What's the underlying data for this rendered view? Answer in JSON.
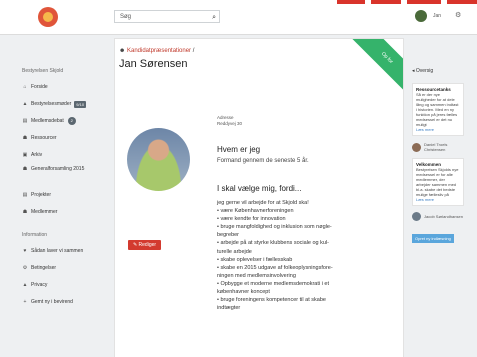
{
  "topbar": {
    "search_placeholder": "Søg",
    "user_name": "Jan"
  },
  "sidebar": {
    "heading": "Bestyrelsen Skjold",
    "items": [
      {
        "label": "Forside",
        "icon": "home-icon"
      },
      {
        "label": "Bestyrelsesmøder",
        "icon": "file-icon",
        "badge": "9/10"
      },
      {
        "label": "Medlemsdebat",
        "icon": "chat-icon",
        "badge": "2"
      },
      {
        "label": "Ressourcer",
        "icon": "people-icon"
      },
      {
        "label": "Arkiv",
        "icon": "archive-icon"
      },
      {
        "label": "Generalforsamling 2015",
        "icon": "people-icon"
      },
      {
        "label": "Projekter",
        "icon": "folder-icon"
      },
      {
        "label": "Medlemmer",
        "icon": "people-icon"
      }
    ],
    "info_heading": "Information",
    "info_items": [
      {
        "label": "Sådan laver vi sammen",
        "icon": "heart-icon"
      },
      {
        "label": "Betingelser",
        "icon": "gear-icon"
      },
      {
        "label": "Privacy",
        "icon": "lock-icon"
      },
      {
        "label": "Gemt ny i bevirend",
        "icon": "plus-icon"
      }
    ]
  },
  "main": {
    "breadcrumb_link": "Kandidatpræsentationer",
    "breadcrumb_sep": "/",
    "person_name": "Jan Sørensen",
    "ribbon_label": "Op for",
    "edit_button": "Rediger",
    "meta_line1": "Adresse",
    "meta_line2": "Reddyvej 30",
    "heading1": "Hvem er jeg",
    "subline": "Formand gennem de seneste 5 år.",
    "heading2": "I skal vælge mig, fordi...",
    "body_lines": [
      "jeg gerne vil arbejde for at Skjold ska!",
      "• være Københavnerforeningen",
      "• være kendte for innovation",
      "• bruge mangfoldighed og inklusion som nøgle-",
      "begreber",
      "• arbejde på at styrke klubbens sociale og kul-",
      "turelle arbejde",
      "• skabe oplevelser i fællesskab",
      "• skabe en 2015 udgave af folkeoplysningsfore-",
      "ningen med medlemsinvolvering",
      "• Opbygge et moderne medlemsdemokrati i et",
      "københavner koncept",
      "• bruge foreningens kompetencer til at skabe",
      "indtægter"
    ]
  },
  "rside": {
    "top_label": "Oversig",
    "card1_title": "Ressourcetanks",
    "card1_text": "Så er der nye muligheder for at dele lång og sammen indtast i historien. Med en ny funktion på jeres fælles medsessel er det nu muligt",
    "card1_link": "Læs mere",
    "user1": "Daniel Troels Christensen",
    "card2_title": "Velkommen",
    "card2_text": "Bestyrelsen Skjolds nye medsessel er for alle medlemmer, der arbejder sammen med bl.a. skabe det bedste mulige fællesliv på",
    "card2_link": "Læs mere",
    "user2": "Jacob Sørlandhansen",
    "button": "Opret ny indlæsning"
  }
}
